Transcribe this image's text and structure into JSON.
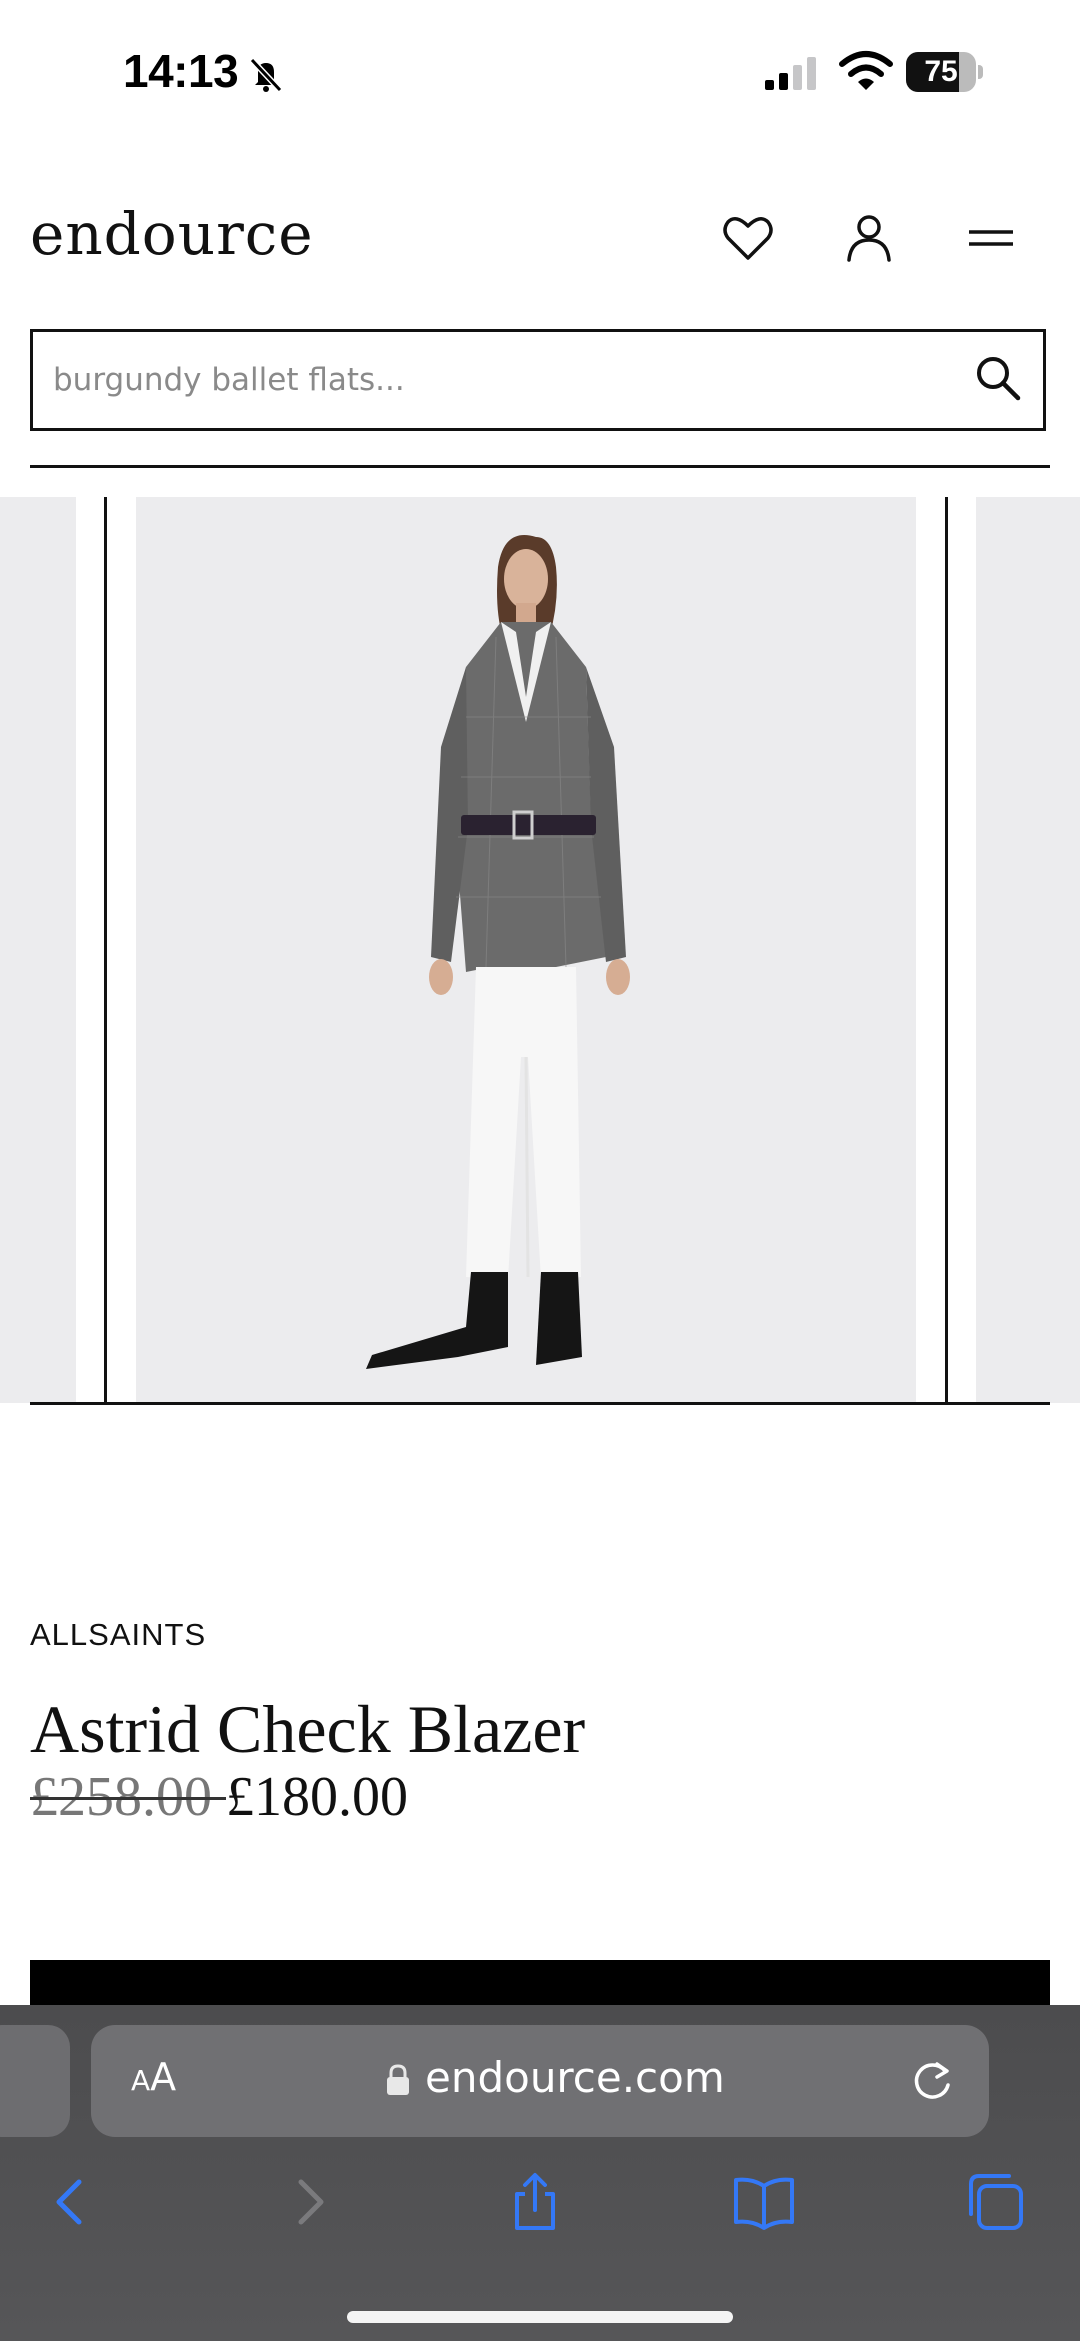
{
  "status_bar": {
    "time": "14:13",
    "battery_percent": "75",
    "battery_level": 0.75
  },
  "header": {
    "logo": "endource",
    "icons": [
      "heart-icon",
      "account-icon",
      "menu-icon"
    ]
  },
  "search": {
    "placeholder": "burgundy ballet flats..."
  },
  "product": {
    "brand": "ALLSAINTS",
    "title": "Astrid Check Blazer",
    "price_old": "£258.00 ",
    "price_new": "£180.00"
  },
  "browser": {
    "text_size_small": "A",
    "text_size_big": "A",
    "url": "endource.com",
    "toolbar_icons": [
      "back-icon",
      "forward-icon",
      "share-icon",
      "bookmarks-icon",
      "tabs-icon"
    ]
  },
  "colors": {
    "accent": "#3478f6",
    "text": "#111111",
    "chrome": "#4f4f51",
    "image_bg": "#ececee"
  }
}
